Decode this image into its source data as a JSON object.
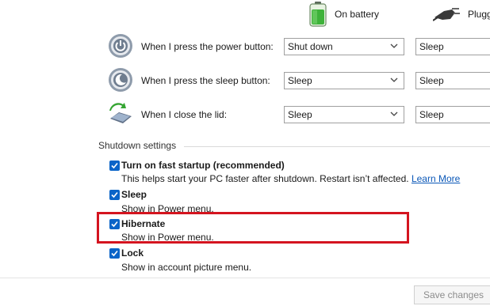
{
  "columns": {
    "battery_label": "On battery",
    "plugged_label": "Plugg"
  },
  "rows": [
    {
      "label": "When I press the power button:",
      "battery": "Shut down",
      "plugged": "Sleep"
    },
    {
      "label": "When I press the sleep button:",
      "battery": "Sleep",
      "plugged": "Sleep"
    },
    {
      "label": "When I close the lid:",
      "battery": "Sleep",
      "plugged": "Sleep"
    }
  ],
  "shutdown": {
    "title": "Shutdown settings",
    "options": [
      {
        "title": "Turn on fast startup (recommended)",
        "desc": "This helps start your PC faster after shutdown. Restart isn’t affected.",
        "link": "Learn More",
        "checked": true
      },
      {
        "title": "Sleep",
        "desc": "Show in Power menu.",
        "checked": true
      },
      {
        "title": "Hibernate",
        "desc": "Show in Power menu.",
        "checked": true
      },
      {
        "title": "Lock",
        "desc": "Show in account picture menu.",
        "checked": true
      }
    ]
  },
  "footer": {
    "save_label": "Save changes"
  },
  "colors": {
    "accent": "#0a64c8",
    "highlight": "#d4141f",
    "link": "#0b58b8"
  }
}
